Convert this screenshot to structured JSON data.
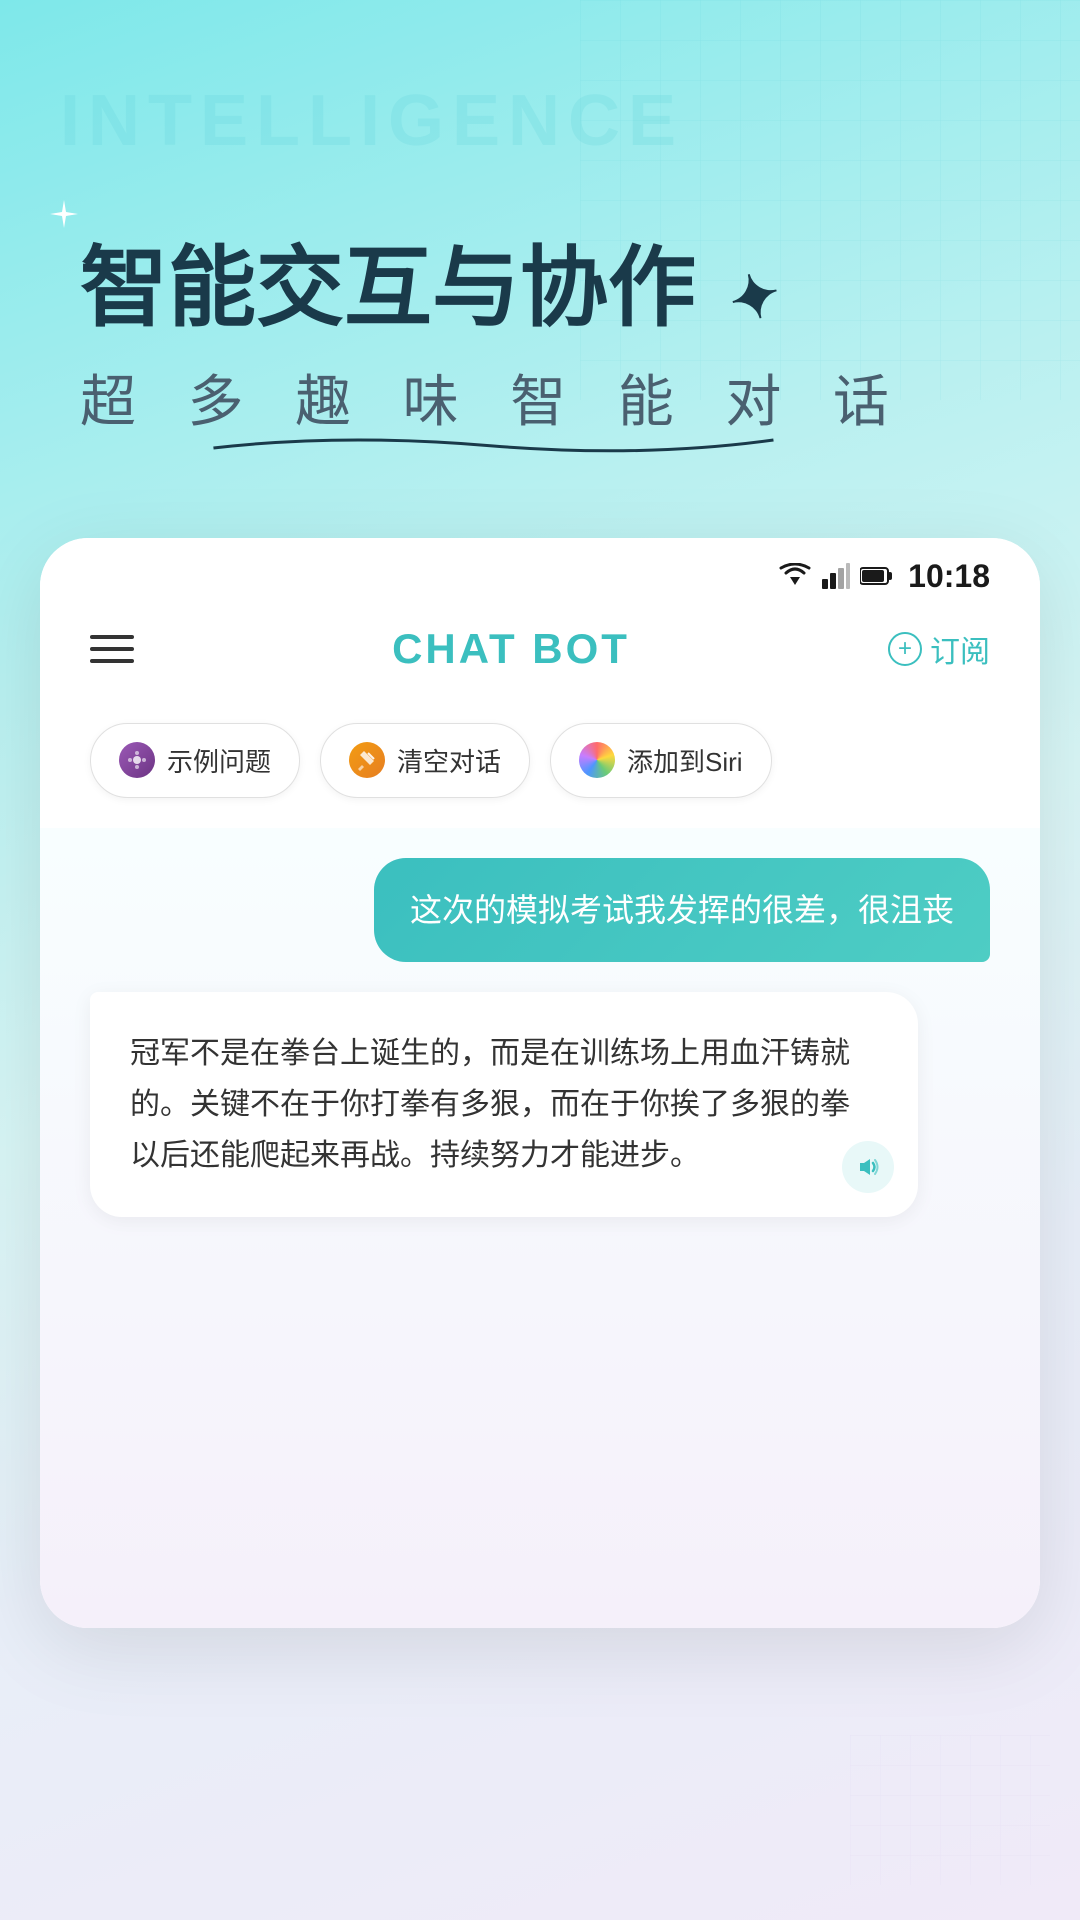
{
  "background": {
    "gradient_start": "#7ee8ea",
    "gradient_end": "#f0eaf8"
  },
  "watermark": "INTELLIGENCE",
  "hero": {
    "main_title": "智能交互与协作",
    "subtitle": "超 多 趣 味 智 能 对 话"
  },
  "status_bar": {
    "time": "10:18"
  },
  "app_header": {
    "title": "CHAT BOT",
    "subscribe_label": "订阅"
  },
  "quick_actions": [
    {
      "id": "examples",
      "label": "示例问题",
      "icon_color": "purple"
    },
    {
      "id": "clear",
      "label": "清空对话",
      "icon_color": "orange"
    },
    {
      "id": "siri",
      "label": "添加到Siri",
      "icon_color": "siri"
    }
  ],
  "chat": {
    "user_message": "这次的模拟考试我发挥的很差，很沮丧",
    "bot_message": "冠军不是在拳台上诞生的，而是在训练场上用血汗铸就的。关键不在于你打拳有多狠，而在于你挨了多狠的拳以后还能爬起来再战。持续努力才能进步。"
  }
}
